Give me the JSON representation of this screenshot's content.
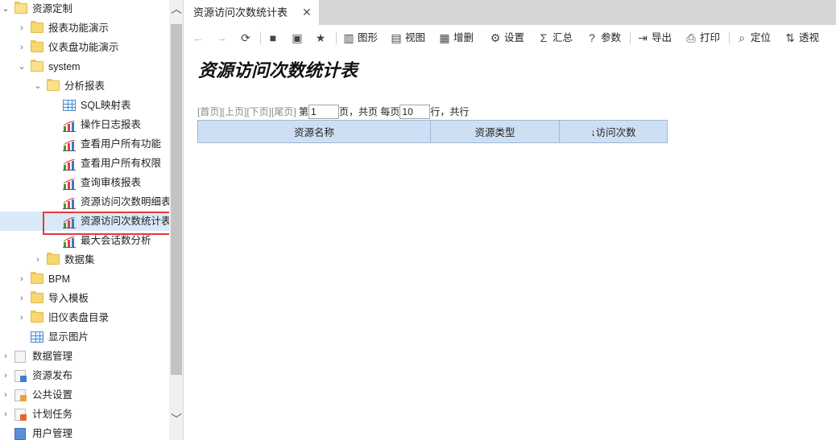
{
  "tree": {
    "items": [
      {
        "label": "资源定制",
        "icon": "folder-icon",
        "arrow": "expanded"
      },
      {
        "label": "报表功能演示",
        "icon": "folder-icon",
        "arrow": "collapsed"
      },
      {
        "label": "仪表盘功能演示",
        "icon": "folder-icon",
        "arrow": "collapsed"
      },
      {
        "label": "system",
        "icon": "folder-icon",
        "arrow": "expanded"
      },
      {
        "label": "分析报表",
        "icon": "folder-icon",
        "arrow": "expanded"
      },
      {
        "label": "SQL映射表",
        "icon": "grid-report-icon",
        "arrow": "none"
      },
      {
        "label": "操作日志报表",
        "icon": "chart-report-icon",
        "arrow": "none"
      },
      {
        "label": "查看用户所有功能",
        "icon": "chart-report-icon",
        "arrow": "none"
      },
      {
        "label": "查看用户所有权限",
        "icon": "chart-report-icon",
        "arrow": "none"
      },
      {
        "label": "查询审核报表",
        "icon": "chart-report-icon",
        "arrow": "none"
      },
      {
        "label": "资源访问次数明细表",
        "icon": "chart-report-icon",
        "arrow": "none"
      },
      {
        "label": "资源访问次数统计表",
        "icon": "chart-report-icon",
        "arrow": "none",
        "selected": true
      },
      {
        "label": "最大会话数分析",
        "icon": "chart-report-icon",
        "arrow": "none"
      },
      {
        "label": "数据集",
        "icon": "folder-icon",
        "arrow": "collapsed"
      },
      {
        "label": "BPM",
        "icon": "folder-icon",
        "arrow": "collapsed"
      },
      {
        "label": "导入模板",
        "icon": "folder-icon",
        "arrow": "collapsed"
      },
      {
        "label": "旧仪表盘目录",
        "icon": "folder-icon",
        "arrow": "collapsed"
      },
      {
        "label": "显示图片",
        "icon": "grid-report-icon",
        "arrow": "none"
      },
      {
        "label": "数据管理",
        "icon": "data-doc-icon",
        "arrow": "collapsed"
      },
      {
        "label": "资源发布",
        "icon": "publish-doc-icon",
        "arrow": "collapsed"
      },
      {
        "label": "公共设置",
        "icon": "settings-doc-icon",
        "arrow": "collapsed"
      },
      {
        "label": "计划任务",
        "icon": "schedule-doc-icon",
        "arrow": "collapsed"
      },
      {
        "label": "用户管理",
        "icon": "user-doc-icon",
        "arrow": "none"
      }
    ]
  },
  "tab": {
    "title": "资源访问次数统计表",
    "close": "✕"
  },
  "toolbar": {
    "back": "←",
    "forward": "→",
    "refresh": "⟳",
    "save": "■",
    "saveas": "▣",
    "favorite": "★",
    "chart_label": "图形",
    "view_label": "视图",
    "edit_label": "增删",
    "settings_label": "设置",
    "sum_label": "汇总",
    "params_label": "参数",
    "export_label": "导出",
    "print_label": "打印",
    "locate_label": "定位",
    "pivot_label": "透视",
    "chart_glyph": "▥",
    "view_glyph": "▤",
    "edit_glyph": "▦",
    "settings_glyph": "⚙",
    "sum_glyph": "Σ",
    "params_glyph": "?",
    "export_glyph": "⇥",
    "print_glyph": "⎙",
    "locate_glyph": "⌕",
    "pivot_glyph": "⇅"
  },
  "report": {
    "title": "资源访问次数统计表",
    "pager": {
      "first": "[首页]",
      "prev": "[上页]",
      "next": "[下页]",
      "last": "[尾页]",
      "page_prefix": "第",
      "page_value": "1",
      "page_suffix": "页，共页 每页",
      "size_value": "10",
      "size_suffix": "行，共行"
    },
    "columns": [
      "资源名称",
      "资源类型",
      "↓访问次数"
    ]
  },
  "colors": {
    "selected_row": "#d9e9f7",
    "highlight_border": "#e03b3b",
    "table_header": "#cfdff3"
  }
}
